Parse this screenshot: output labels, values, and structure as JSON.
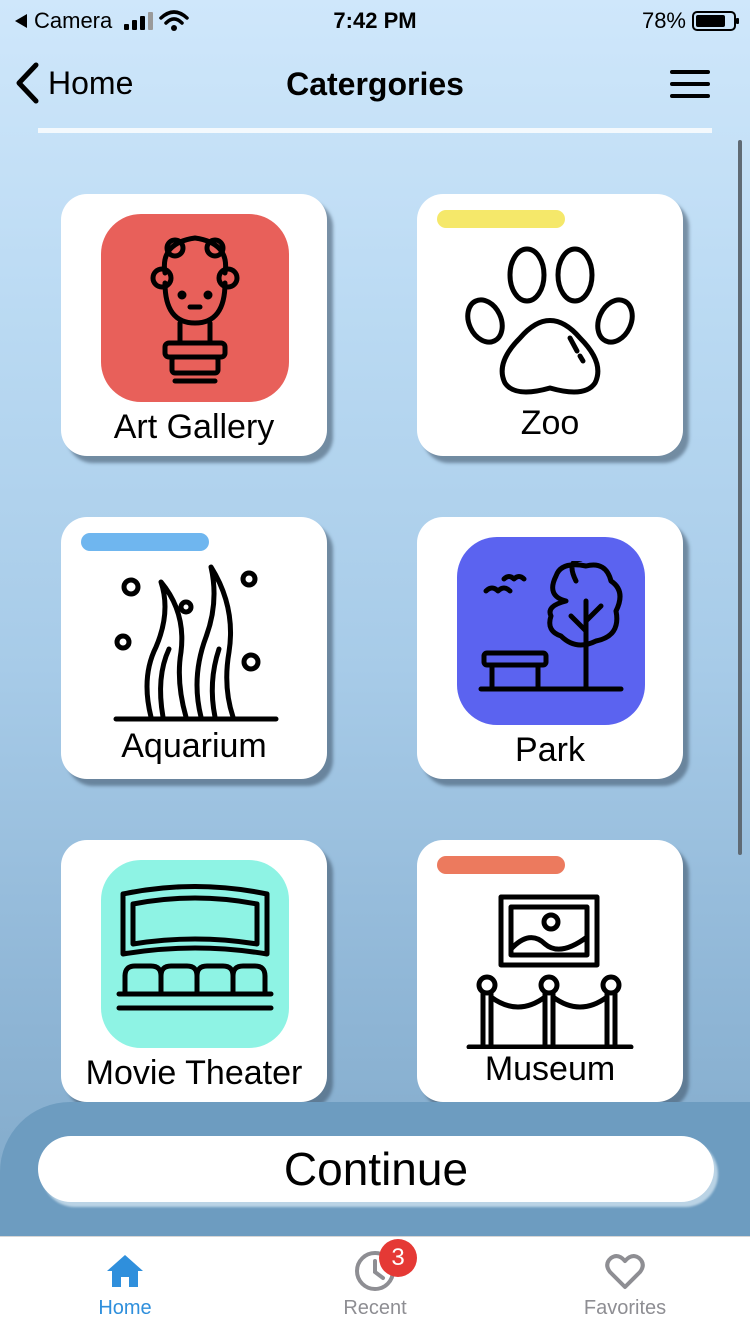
{
  "status_bar": {
    "carrier": "Camera",
    "time": "7:42 PM",
    "battery_percent": "78%",
    "battery_level": 0.78
  },
  "nav": {
    "back_label": "Home",
    "title": "Catergories"
  },
  "categories": [
    {
      "label": "Art Gallery",
      "icon": "statue-icon",
      "icon_bg": "#e8605a"
    },
    {
      "label": "Zoo",
      "icon": "paw-icon",
      "accent": "#f5e86a"
    },
    {
      "label": "Aquarium",
      "icon": "seaweed-icon",
      "accent": "#6fb6ef"
    },
    {
      "label": "Park",
      "icon": "tree-bench-icon",
      "icon_bg": "#5b63f0"
    },
    {
      "label": "Movie Theater",
      "icon": "cinema-icon",
      "icon_bg": "#8ef3e4"
    },
    {
      "label": "Museum",
      "icon": "museum-frame-icon",
      "accent": "#ec7a5e"
    }
  ],
  "continue_label": "Continue",
  "tabs": [
    {
      "label": "Home",
      "icon": "home-icon",
      "active": true
    },
    {
      "label": "Recent",
      "icon": "clock-icon",
      "badge": "3"
    },
    {
      "label": "Favorites",
      "icon": "heart-icon"
    }
  ],
  "colors": {
    "accent": "#2f8fdc",
    "badge": "#e53935"
  }
}
